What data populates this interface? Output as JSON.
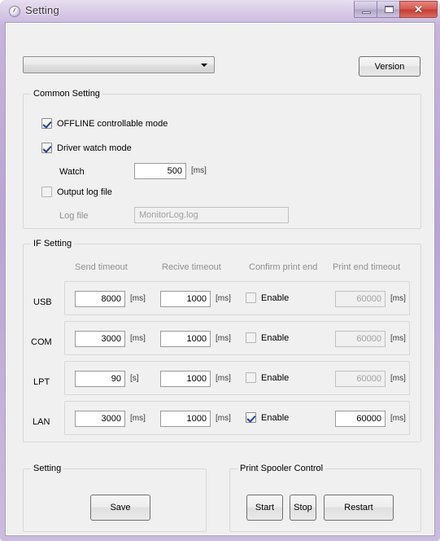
{
  "window": {
    "title": "Setting",
    "icon": "clock-icon",
    "accent_color": "#b9a4d2",
    "client_bg": "#f0f0f0",
    "buttons": {
      "minimize": "minimize-icon",
      "maximize": "maximize-icon",
      "close": "✕"
    }
  },
  "top": {
    "printer_select_value": "",
    "version_label": "Version"
  },
  "common_setting": {
    "legend": "Common Setting",
    "offline_mode": {
      "label": "OFFLINE controllable mode",
      "checked": true
    },
    "driver_watch_mode": {
      "label": "Driver watch mode",
      "checked": true
    },
    "watch": {
      "label": "Watch",
      "value": "500",
      "unit": "[ms]"
    },
    "output_log_file": {
      "label": "Output log file",
      "checked": false
    },
    "log_file": {
      "label": "Log file",
      "value": "MonitorLog.log",
      "enabled": false
    }
  },
  "if_setting": {
    "legend": "IF Setting",
    "columns": [
      "Send timeout",
      "Recive timeout",
      "Confirm print end",
      "Print end timeout"
    ],
    "enable_label": "Enable",
    "rows": [
      {
        "name": "USB",
        "send_timeout": "8000",
        "send_unit": "[ms]",
        "recive_timeout": "1000",
        "recive_unit": "[ms]",
        "confirm_print_end": false,
        "print_end_timeout": "60000",
        "print_end_unit": "[ms]",
        "print_end_enabled": false
      },
      {
        "name": "COM",
        "send_timeout": "3000",
        "send_unit": "[ms]",
        "recive_timeout": "1000",
        "recive_unit": "[ms]",
        "confirm_print_end": false,
        "print_end_timeout": "60000",
        "print_end_unit": "[ms]",
        "print_end_enabled": false
      },
      {
        "name": "LPT",
        "send_timeout": "90",
        "send_unit": "[s]",
        "recive_timeout": "1000",
        "recive_unit": "[ms]",
        "confirm_print_end": false,
        "print_end_timeout": "60000",
        "print_end_unit": "[ms]",
        "print_end_enabled": false
      },
      {
        "name": "LAN",
        "send_timeout": "3000",
        "send_unit": "[ms]",
        "recive_timeout": "1000",
        "recive_unit": "[ms]",
        "confirm_print_end": true,
        "print_end_timeout": "60000",
        "print_end_unit": "[ms]",
        "print_end_enabled": true
      }
    ]
  },
  "setting_group": {
    "legend": "Setting",
    "save_label": "Save"
  },
  "spooler_group": {
    "legend": "Print Spooler Control",
    "start_label": "Start",
    "stop_label": "Stop",
    "restart_label": "Restart"
  }
}
